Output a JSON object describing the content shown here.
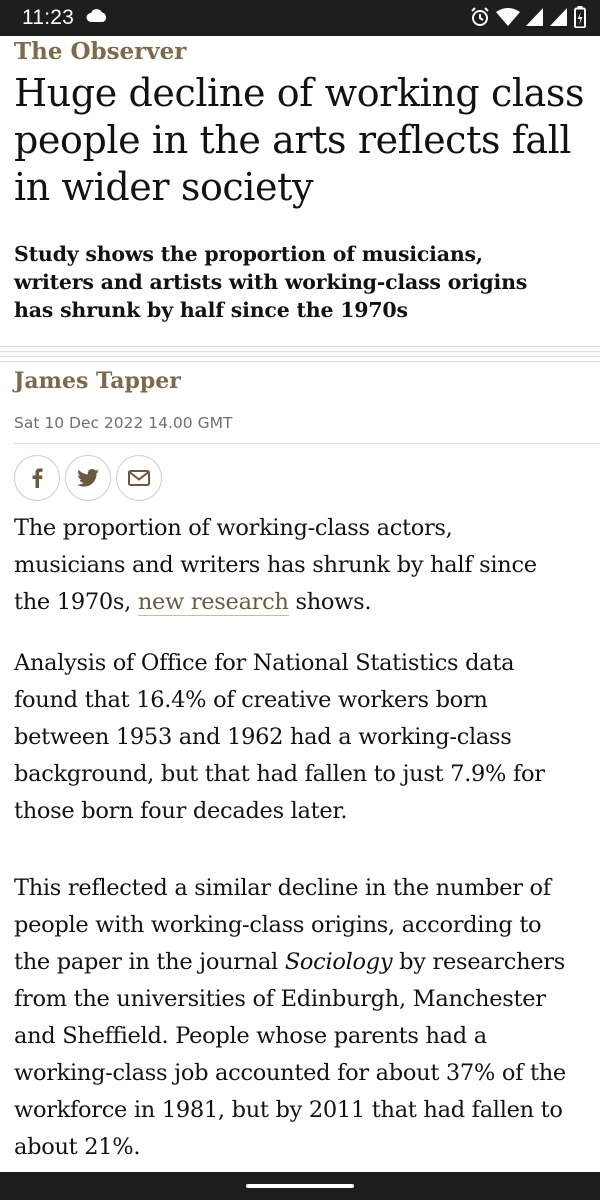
{
  "status": {
    "time": "11:23",
    "icons": [
      "cloud-icon",
      "alarm-icon",
      "wifi-icon",
      "signal-icon",
      "signal-icon",
      "battery-icon"
    ]
  },
  "article": {
    "publication": "The Observer",
    "headline_lines": [
      "Huge decline of working class",
      "people in the arts reflects fall",
      "in wider society"
    ],
    "standfirst_lines": [
      "Study shows the proportion of musicians,",
      "writers and artists with working-class origins",
      "has shrunk by half since the 1970s"
    ],
    "author": "James Tapper",
    "date": "Sat 10 Dec 2022 14.00 GMT",
    "share_icons": [
      "facebook-icon",
      "twitter-icon",
      "email-icon"
    ],
    "p1": {
      "line1": "The proportion of working-class actors,",
      "line2": "musicians and writers has shrunk by half since",
      "line3_pre": "the 1970s, ",
      "link_text": "new research",
      "line3_post": " shows."
    },
    "p2_lines": [
      "Analysis of Office for National Statistics data",
      "found that 16.4% of creative workers born",
      "between 1953 and 1962 had a working-class",
      "background, but that had fallen to just 7.9% for",
      "those born four decades later."
    ],
    "p3": {
      "line1": "This reflected a similar decline in the number of",
      "line2": "people with working-class origins, according to",
      "line3_pre": "the paper in the journal ",
      "journal": "Sociology",
      "line3_post": " by researchers",
      "line4": "from the universities of Edinburgh, Manchester",
      "line5": "and Sheffield. People whose parents had a",
      "line6": "working-class job accounted for about 37% of the",
      "line7": "workforce in 1981, but by 2011 that had fallen to",
      "line8": "about 21%."
    }
  }
}
